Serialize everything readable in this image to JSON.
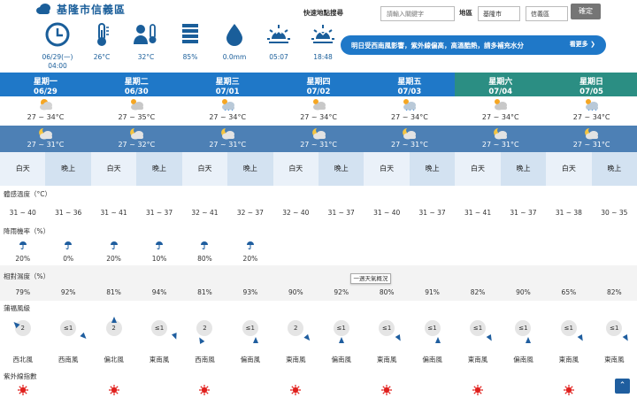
{
  "header": {
    "title": "基隆市信義區",
    "observations": [
      {
        "icon": "clock-icon",
        "value": "06/29(一)\n04:00"
      },
      {
        "icon": "thermometer-icon",
        "value": "26°C"
      },
      {
        "icon": "apparent-temp-icon",
        "value": "32°C"
      },
      {
        "icon": "humidity-icon",
        "value": "85%"
      },
      {
        "icon": "rain-drop-icon",
        "value": "0.0mm"
      },
      {
        "icon": "sunrise-icon",
        "value": "05:07"
      },
      {
        "icon": "sunset-icon",
        "value": "18:48"
      }
    ],
    "quick_search": {
      "label": "快速地點搜尋",
      "placeholder": "請輸入關鍵字",
      "area_label": "地區",
      "city": "基隆市",
      "district": "信義區",
      "confirm": "確定"
    },
    "notice": {
      "text": "明日受西南風影響，紫外線偏高，高溫酷熱，請多補充水分",
      "more": "看更多 ❯"
    }
  },
  "colors": {
    "weekday_head": "#1f78c8",
    "weekend_head": "#2b8e83",
    "night_row": "#4d80b5"
  },
  "days": [
    {
      "weekday": "星期一",
      "date": "06/29",
      "day_temp": "27 ~ 34°C",
      "night_temp": "27 ~ 31°C",
      "day_icon": "sunny-cloud-icon",
      "night_icon": "moon-cloud-icon",
      "weekend": false
    },
    {
      "weekday": "星期二",
      "date": "06/30",
      "day_temp": "27 ~ 35°C",
      "night_temp": "27 ~ 32°C",
      "day_icon": "cloudy-icon",
      "night_icon": "moon-cloud-icon",
      "weekend": false
    },
    {
      "weekday": "星期三",
      "date": "07/01",
      "day_temp": "27 ~ 34°C",
      "night_temp": "27 ~ 31°C",
      "day_icon": "shower-icon",
      "night_icon": "moon-cloud-icon",
      "weekend": false
    },
    {
      "weekday": "星期四",
      "date": "07/02",
      "day_temp": "27 ~ 34°C",
      "night_temp": "27 ~ 31°C",
      "day_icon": "cloudy-icon",
      "night_icon": "moon-cloud-icon",
      "weekend": false
    },
    {
      "weekday": "星期五",
      "date": "07/03",
      "day_temp": "27 ~ 34°C",
      "night_temp": "27 ~ 31°C",
      "day_icon": "shower-icon",
      "night_icon": "moon-cloud-icon",
      "weekend": false
    },
    {
      "weekday": "星期六",
      "date": "07/04",
      "day_temp": "27 ~ 34°C",
      "night_temp": "27 ~ 31°C",
      "day_icon": "cloudy-icon",
      "night_icon": "moon-cloud-icon",
      "weekend": true
    },
    {
      "weekday": "星期日",
      "date": "07/05",
      "day_temp": "27 ~ 34°C",
      "night_temp": "27 ~ 31°C",
      "day_icon": "shower-icon",
      "night_icon": "moon-cloud-icon",
      "weekend": true
    }
  ],
  "period_labels": {
    "day": "白天",
    "night": "晚上"
  },
  "sections": {
    "apparent": {
      "label": "體感溫度（°C）",
      "values": [
        "31 ~ 40",
        "31 ~ 36",
        "31 ~ 41",
        "31 ~ 37",
        "32 ~ 41",
        "32 ~ 37",
        "32 ~ 40",
        "31 ~ 37",
        "31 ~ 40",
        "31 ~ 37",
        "31 ~ 41",
        "31 ~ 37",
        "31 ~ 38",
        "30 ~ 35"
      ]
    },
    "rain": {
      "label": "降雨機率（%）",
      "values": [
        "20%",
        "0%",
        "20%",
        "10%",
        "80%",
        "20%"
      ]
    },
    "humidity": {
      "label": "相對濕度（%）",
      "values": [
        "79%",
        "92%",
        "81%",
        "94%",
        "81%",
        "93%",
        "90%",
        "92%",
        "80%",
        "91%",
        "82%",
        "90%",
        "65%",
        "82%"
      ]
    },
    "wind": {
      "label": "蒲福風級",
      "levels": [
        "2",
        "≤1",
        "2",
        "≤1",
        "2",
        "≤1",
        "2",
        "≤1",
        "≤1",
        "≤1",
        "≤1",
        "≤1",
        "≤1",
        "≤1"
      ],
      "directions": [
        "西北風",
        "西南風",
        "偏北風",
        "東南風",
        "西南風",
        "偏南風",
        "東南風",
        "偏南風",
        "東南風",
        "偏南風",
        "東南風",
        "偏南風",
        "東南風",
        "東南風"
      ]
    },
    "uv": {
      "label": "紫外線指數"
    }
  },
  "tooltip": "一週天氣概況",
  "scroll_top": "⌃"
}
